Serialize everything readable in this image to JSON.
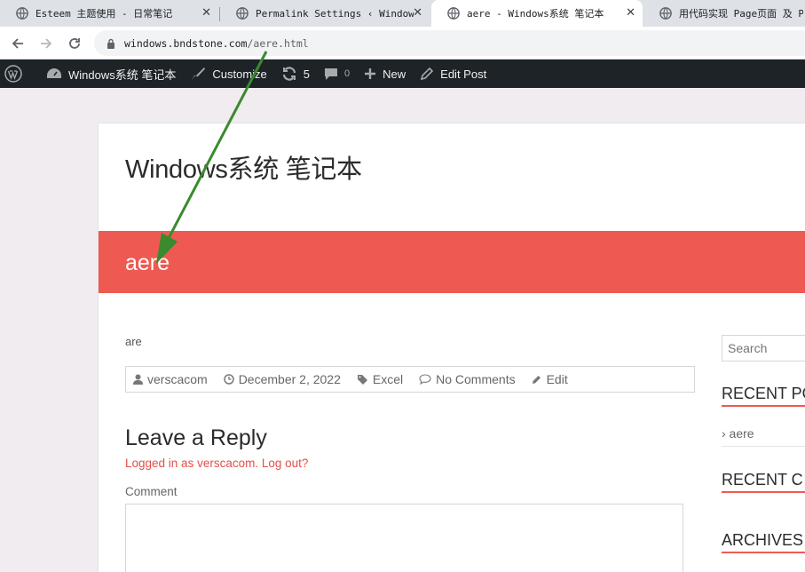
{
  "browser": {
    "tabs": [
      {
        "title": "Esteem 主题使用 - 日常笔记",
        "close": "✕"
      },
      {
        "title": "Permalink Settings ‹ Windows系",
        "close": "✕"
      },
      {
        "title": "aere - Windows系统 笔记本",
        "close": "✕"
      },
      {
        "title": "用代码实现 Page页面 及 Pr",
        "close": ""
      }
    ],
    "url_host": "windows.bndstone.com",
    "url_path": "/aere.html"
  },
  "adminbar": {
    "site_name": "Windows系统 笔记本",
    "customize": "Customize",
    "updates_count": "5",
    "comments_count": "0",
    "new_label": "New",
    "edit_post": "Edit Post"
  },
  "site": {
    "title": "Windows系统 笔记本"
  },
  "post": {
    "title": "aere",
    "content": "are",
    "author": "verscacom",
    "date": "December 2, 2022",
    "category": "Excel",
    "comments": "No Comments",
    "edit": "Edit"
  },
  "reply": {
    "title": "Leave a Reply",
    "logged_in": "Logged in as verscacom. Log out?",
    "comment_label": "Comment"
  },
  "sidebar": {
    "search_placeholder": "Search",
    "recent_posts_title": "RECENT PO",
    "recent_post_item": "› aere",
    "recent_comments_title": "RECENT C",
    "archives_title": "ARCHIVES"
  },
  "colors": {
    "accent": "#ee5a52",
    "adminbar": "#1d2327",
    "annotation_arrow": "#3a8a2e"
  },
  "icons": [
    "globe-icon",
    "back-icon",
    "forward-icon",
    "reload-icon",
    "lock-icon",
    "wordpress-icon",
    "dashboard-icon",
    "brush-icon",
    "updates-icon",
    "comment-icon",
    "plus-icon",
    "pencil-icon",
    "user-icon",
    "clock-icon",
    "tag-icon",
    "chat-icon",
    "edit-icon"
  ]
}
